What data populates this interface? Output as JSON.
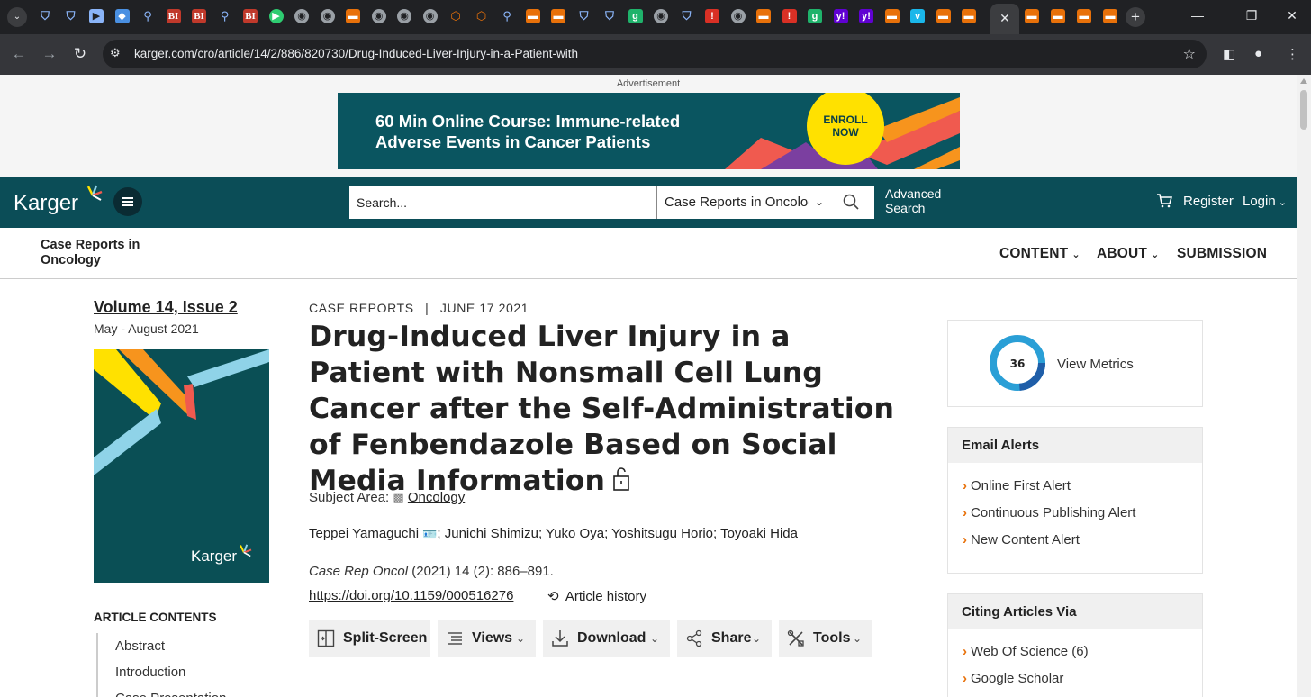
{
  "browser": {
    "url": "karger.com/cro/article/14/2/886/820730/Drug-Induced-Liver-Injury-in-a-Patient-with",
    "tabs": [
      {
        "icon": "shield-icon",
        "glyph": "⛉",
        "cls": "fav-shield"
      },
      {
        "icon": "shield-icon",
        "glyph": "⛉",
        "cls": "fav-shield"
      },
      {
        "icon": "document-icon",
        "glyph": "▶",
        "cls": "fav-doc"
      },
      {
        "icon": "graduation-cap-icon",
        "glyph": "◆",
        "cls": "fav-cap"
      },
      {
        "icon": "search-icon",
        "glyph": "⚲",
        "cls": "fav-search"
      },
      {
        "icon": "bi-logo-icon",
        "glyph": "BI",
        "cls": "fav-bi"
      },
      {
        "icon": "bi-logo-icon",
        "glyph": "BI",
        "cls": "fav-bi"
      },
      {
        "icon": "search-icon",
        "glyph": "⚲",
        "cls": "fav-search"
      },
      {
        "icon": "bi-logo-icon",
        "glyph": "BI",
        "cls": "fav-bi"
      },
      {
        "icon": "play-icon",
        "glyph": "▶",
        "cls": "fav-play"
      },
      {
        "icon": "globe-icon",
        "glyph": "◉",
        "cls": "fav-globe"
      },
      {
        "icon": "globe-icon",
        "glyph": "◉",
        "cls": "fav-globe"
      },
      {
        "icon": "bookmark-icon",
        "glyph": "▬",
        "cls": "fav-book"
      },
      {
        "icon": "globe-icon",
        "glyph": "◉",
        "cls": "fav-globe"
      },
      {
        "icon": "globe-icon",
        "glyph": "◉",
        "cls": "fav-globe"
      },
      {
        "icon": "globe-icon",
        "glyph": "◉",
        "cls": "fav-globe"
      },
      {
        "icon": "badge-icon",
        "glyph": "⬡",
        "cls": "fav-badge"
      },
      {
        "icon": "badge-icon",
        "glyph": "⬡",
        "cls": "fav-badge"
      },
      {
        "icon": "search-icon",
        "glyph": "⚲",
        "cls": "fav-search"
      },
      {
        "icon": "bookmark-icon",
        "glyph": "▬",
        "cls": "fav-book"
      },
      {
        "icon": "bookmark-icon",
        "glyph": "▬",
        "cls": "fav-book"
      },
      {
        "icon": "shield-icon",
        "glyph": "⛉",
        "cls": "fav-shield"
      },
      {
        "icon": "shield-icon",
        "glyph": "⛉",
        "cls": "fav-shield"
      },
      {
        "icon": "g-logo-icon",
        "glyph": "g",
        "cls": "fav-g"
      },
      {
        "icon": "globe-icon",
        "glyph": "◉",
        "cls": "fav-globe"
      },
      {
        "icon": "shield-icon",
        "glyph": "⛉",
        "cls": "fav-shield"
      },
      {
        "icon": "red-app-icon",
        "glyph": "!",
        "cls": "fav-red"
      },
      {
        "icon": "globe-icon",
        "glyph": "◉",
        "cls": "fav-globe"
      },
      {
        "icon": "bookmark-icon",
        "glyph": "▬",
        "cls": "fav-book"
      },
      {
        "icon": "red-app-icon",
        "glyph": "!",
        "cls": "fav-red"
      },
      {
        "icon": "g-logo-icon",
        "glyph": "g",
        "cls": "fav-g"
      },
      {
        "icon": "yahoo-icon",
        "glyph": "y!",
        "cls": "fav-yahoo"
      },
      {
        "icon": "yahoo-icon",
        "glyph": "y!",
        "cls": "fav-yahoo"
      },
      {
        "icon": "bookmark-icon",
        "glyph": "▬",
        "cls": "fav-book"
      },
      {
        "icon": "vimeo-icon",
        "glyph": "v",
        "cls": "fav-vimeo"
      },
      {
        "icon": "bookmark-icon",
        "glyph": "▬",
        "cls": "fav-book"
      },
      {
        "icon": "bookmark-icon",
        "glyph": "▬",
        "cls": "fav-book"
      }
    ],
    "tabs_after_active": [
      {
        "icon": "bookmark-icon",
        "glyph": "▬",
        "cls": "fav-book"
      },
      {
        "icon": "bookmark-icon",
        "glyph": "▬",
        "cls": "fav-book"
      },
      {
        "icon": "bookmark-icon",
        "glyph": "▬",
        "cls": "fav-book"
      },
      {
        "icon": "bookmark-icon",
        "glyph": "▬",
        "cls": "fav-book"
      }
    ]
  },
  "ad": {
    "label": "Advertisement",
    "title_line1": "60 Min Online Course: Immune-related",
    "title_line2": "Adverse Events in Cancer Patients",
    "cta_line1": "ENROLL",
    "cta_line2": "NOW"
  },
  "header": {
    "logo": "Karger",
    "search_placeholder": "Search...",
    "scope": "Case Reports in Oncology",
    "advanced_line1": "Advanced",
    "advanced_line2": "Search",
    "register": "Register",
    "login": "Login"
  },
  "journal": {
    "name_line1": "Case Reports in",
    "name_line2": "Oncology",
    "nav": [
      "CONTENT",
      "ABOUT",
      "SUBMISSION"
    ]
  },
  "issue": {
    "volume": "Volume 14, Issue 2",
    "dates": "May - August 2021",
    "cover_logo": "Karger"
  },
  "contents": {
    "heading": "ARTICLE CONTENTS",
    "items": [
      "Abstract",
      "Introduction",
      "Case Presentation"
    ]
  },
  "article": {
    "type": "CASE REPORTS",
    "date": "JUNE 17 2021",
    "title": "Drug-Induced Liver Injury in a Patient with Nonsmall Cell Lung Cancer after the Self-Administration of Fenbendazole Based on Social Media Information",
    "subject_label": "Subject Area:",
    "subject": "Oncology",
    "authors": [
      "Teppei Yamaguchi",
      "Junichi Shimizu",
      "Yuko Oya",
      "Yoshitsugu Horio",
      "Toyoaki Hida"
    ],
    "journal_abbrev": "Case Rep Oncol",
    "citation_rest": "(2021) 14 (2): 886–891.",
    "doi": "https://doi.org/10.1159/000516276",
    "history": "Article history"
  },
  "tools": {
    "split": "Split-Screen",
    "views": "Views",
    "download": "Download",
    "share": "Share",
    "tools": "Tools"
  },
  "metrics": {
    "score": "36",
    "link": "View Metrics"
  },
  "email_alerts": {
    "heading": "Email Alerts",
    "items": [
      "Online First Alert",
      "Continuous Publishing Alert",
      "New Content Alert"
    ]
  },
  "citing": {
    "heading": "Citing Articles Via",
    "items": [
      "Web Of Science (6)",
      "Google Scholar"
    ]
  },
  "colors": {
    "brand_teal": "#0b4d57",
    "ad_yellow": "#ffe100",
    "accent_orange": "#e8710a"
  }
}
